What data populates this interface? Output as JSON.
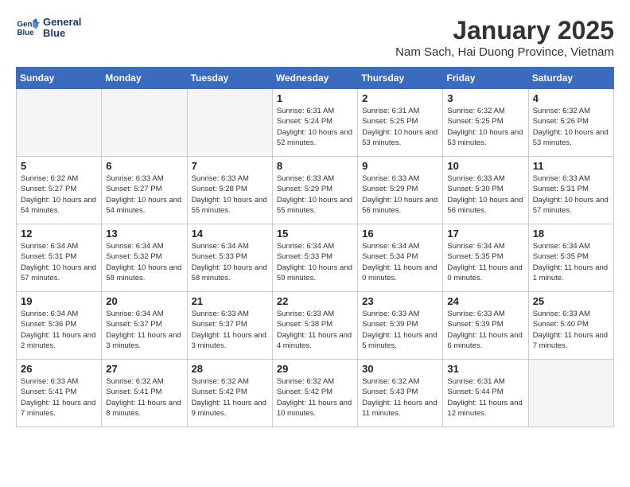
{
  "header": {
    "logo_line1": "General",
    "logo_line2": "Blue",
    "month_title": "January 2025",
    "subtitle": "Nam Sach, Hai Duong Province, Vietnam"
  },
  "weekdays": [
    "Sunday",
    "Monday",
    "Tuesday",
    "Wednesday",
    "Thursday",
    "Friday",
    "Saturday"
  ],
  "weeks": [
    [
      {
        "day": null
      },
      {
        "day": null
      },
      {
        "day": null
      },
      {
        "day": 1,
        "sunrise": "6:31 AM",
        "sunset": "5:24 PM",
        "daylight": "10 hours and 52 minutes."
      },
      {
        "day": 2,
        "sunrise": "6:31 AM",
        "sunset": "5:25 PM",
        "daylight": "10 hours and 53 minutes."
      },
      {
        "day": 3,
        "sunrise": "6:32 AM",
        "sunset": "5:25 PM",
        "daylight": "10 hours and 53 minutes."
      },
      {
        "day": 4,
        "sunrise": "6:32 AM",
        "sunset": "5:26 PM",
        "daylight": "10 hours and 53 minutes."
      }
    ],
    [
      {
        "day": 5,
        "sunrise": "6:32 AM",
        "sunset": "5:27 PM",
        "daylight": "10 hours and 54 minutes."
      },
      {
        "day": 6,
        "sunrise": "6:33 AM",
        "sunset": "5:27 PM",
        "daylight": "10 hours and 54 minutes."
      },
      {
        "day": 7,
        "sunrise": "6:33 AM",
        "sunset": "5:28 PM",
        "daylight": "10 hours and 55 minutes."
      },
      {
        "day": 8,
        "sunrise": "6:33 AM",
        "sunset": "5:29 PM",
        "daylight": "10 hours and 55 minutes."
      },
      {
        "day": 9,
        "sunrise": "6:33 AM",
        "sunset": "5:29 PM",
        "daylight": "10 hours and 56 minutes."
      },
      {
        "day": 10,
        "sunrise": "6:33 AM",
        "sunset": "5:30 PM",
        "daylight": "10 hours and 56 minutes."
      },
      {
        "day": 11,
        "sunrise": "6:33 AM",
        "sunset": "5:31 PM",
        "daylight": "10 hours and 57 minutes."
      }
    ],
    [
      {
        "day": 12,
        "sunrise": "6:34 AM",
        "sunset": "5:31 PM",
        "daylight": "10 hours and 57 minutes."
      },
      {
        "day": 13,
        "sunrise": "6:34 AM",
        "sunset": "5:32 PM",
        "daylight": "10 hours and 58 minutes."
      },
      {
        "day": 14,
        "sunrise": "6:34 AM",
        "sunset": "5:33 PM",
        "daylight": "10 hours and 58 minutes."
      },
      {
        "day": 15,
        "sunrise": "6:34 AM",
        "sunset": "5:33 PM",
        "daylight": "10 hours and 59 minutes."
      },
      {
        "day": 16,
        "sunrise": "6:34 AM",
        "sunset": "5:34 PM",
        "daylight": "11 hours and 0 minutes."
      },
      {
        "day": 17,
        "sunrise": "6:34 AM",
        "sunset": "5:35 PM",
        "daylight": "11 hours and 0 minutes."
      },
      {
        "day": 18,
        "sunrise": "6:34 AM",
        "sunset": "5:35 PM",
        "daylight": "11 hours and 1 minute."
      }
    ],
    [
      {
        "day": 19,
        "sunrise": "6:34 AM",
        "sunset": "5:36 PM",
        "daylight": "11 hours and 2 minutes."
      },
      {
        "day": 20,
        "sunrise": "6:34 AM",
        "sunset": "5:37 PM",
        "daylight": "11 hours and 3 minutes."
      },
      {
        "day": 21,
        "sunrise": "6:33 AM",
        "sunset": "5:37 PM",
        "daylight": "11 hours and 3 minutes."
      },
      {
        "day": 22,
        "sunrise": "6:33 AM",
        "sunset": "5:38 PM",
        "daylight": "11 hours and 4 minutes."
      },
      {
        "day": 23,
        "sunrise": "6:33 AM",
        "sunset": "5:39 PM",
        "daylight": "11 hours and 5 minutes."
      },
      {
        "day": 24,
        "sunrise": "6:33 AM",
        "sunset": "5:39 PM",
        "daylight": "11 hours and 6 minutes."
      },
      {
        "day": 25,
        "sunrise": "6:33 AM",
        "sunset": "5:40 PM",
        "daylight": "11 hours and 7 minutes."
      }
    ],
    [
      {
        "day": 26,
        "sunrise": "6:33 AM",
        "sunset": "5:41 PM",
        "daylight": "11 hours and 7 minutes."
      },
      {
        "day": 27,
        "sunrise": "6:32 AM",
        "sunset": "5:41 PM",
        "daylight": "11 hours and 8 minutes."
      },
      {
        "day": 28,
        "sunrise": "6:32 AM",
        "sunset": "5:42 PM",
        "daylight": "11 hours and 9 minutes."
      },
      {
        "day": 29,
        "sunrise": "6:32 AM",
        "sunset": "5:42 PM",
        "daylight": "11 hours and 10 minutes."
      },
      {
        "day": 30,
        "sunrise": "6:32 AM",
        "sunset": "5:43 PM",
        "daylight": "11 hours and 11 minutes."
      },
      {
        "day": 31,
        "sunrise": "6:31 AM",
        "sunset": "5:44 PM",
        "daylight": "11 hours and 12 minutes."
      },
      {
        "day": null
      }
    ]
  ]
}
